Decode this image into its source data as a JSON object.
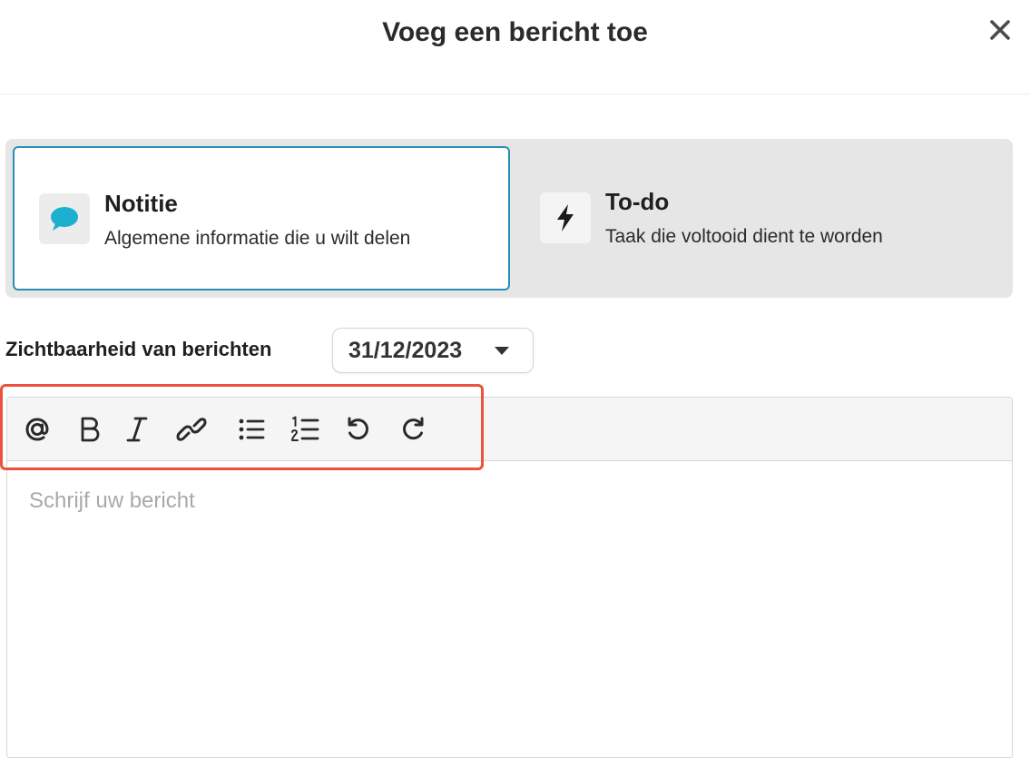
{
  "dialog": {
    "title": "Voeg een bericht toe",
    "close_icon": "close-icon"
  },
  "message_types": [
    {
      "label": "Notitie",
      "description": "Algemene informatie die u wilt delen",
      "icon": "speech-bubble-icon",
      "icon_color": "#1bb0d0",
      "selected": true
    },
    {
      "label": "To-do",
      "description": "Taak die voltooid dient te worden",
      "icon": "lightning-bolt-icon",
      "icon_color": "#1a1a1a",
      "selected": false
    }
  ],
  "visibility": {
    "label": "Zichtbaarheid van berichten",
    "date_value": "31/12/2023",
    "caret_icon": "caret-down-icon"
  },
  "editor": {
    "toolbar": [
      {
        "name": "mention",
        "icon": "at-sign-icon"
      },
      {
        "name": "bold",
        "icon": "bold-icon"
      },
      {
        "name": "italic",
        "icon": "italic-icon"
      },
      {
        "name": "link",
        "icon": "link-icon"
      },
      {
        "name": "bullet-list",
        "icon": "bullet-list-icon"
      },
      {
        "name": "numbered-list",
        "icon": "numbered-list-icon"
      },
      {
        "name": "undo",
        "icon": "undo-icon"
      },
      {
        "name": "redo",
        "icon": "redo-icon"
      }
    ],
    "placeholder": "Schrijf uw bericht",
    "value": ""
  },
  "colors": {
    "selected_border": "#2a8fb8",
    "highlight": "#e8533a",
    "panel_bg": "#e6e6e6"
  }
}
